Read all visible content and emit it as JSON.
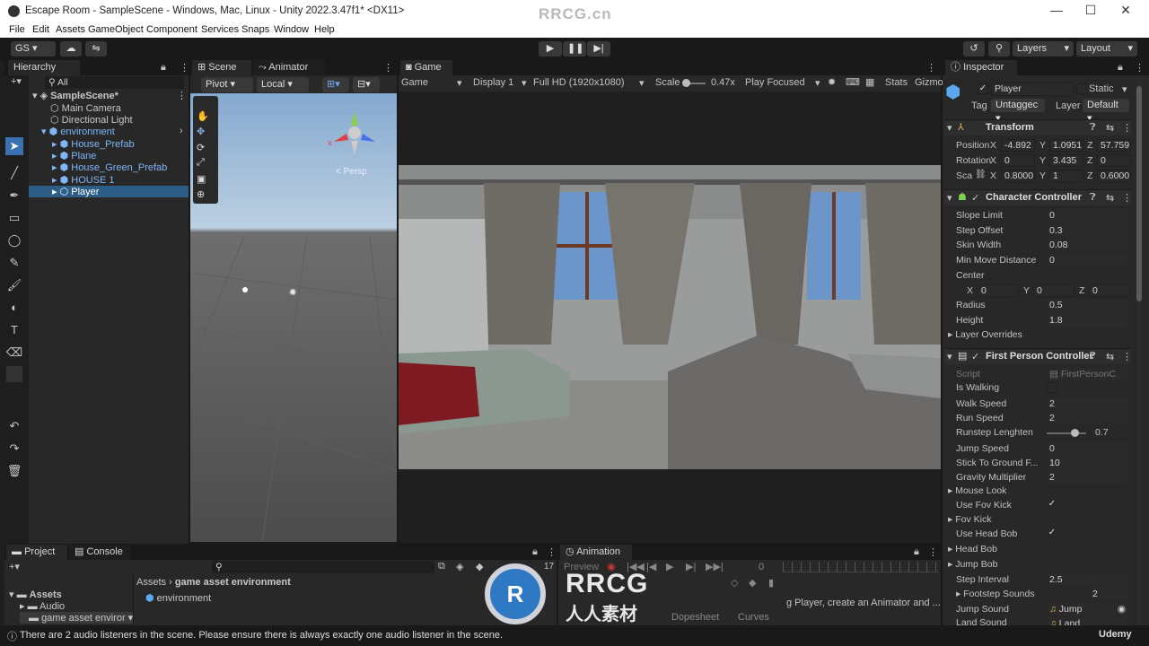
{
  "window": {
    "title": "Escape Room - SampleScene - Windows, Mac, Linux - Unity 2022.3.47f1* <DX11>",
    "watermark": "RRCG.cn",
    "minimize": "—",
    "maximize": "☐",
    "close": "✕"
  },
  "menu": [
    "File",
    "Edit",
    "Assets",
    "GameObject",
    "Component",
    "Services",
    "Snaps",
    "Window",
    "Help"
  ],
  "toolbar": {
    "account": "GS ▾",
    "layers": "Layers",
    "layout": "Layout"
  },
  "hierarchy": {
    "tab": "Hierarchy",
    "search_placeholder": "All",
    "scene": "SampleScene*",
    "items": [
      "Main Camera",
      "Directional Light",
      "environment",
      "House_Prefab",
      "Plane",
      "House_Green_Prefab",
      "HOUSE 1",
      "Player"
    ]
  },
  "scene": {
    "tab": "Scene",
    "tab2": "Animator",
    "pivot": "Pivot",
    "local": "Local",
    "persp": "< Persp",
    "axis_x": "x",
    "axis_z": "z",
    "axis_y": "y"
  },
  "game": {
    "tab": "Game",
    "mode": "Game",
    "display": "Display 1",
    "resolution": "Full HD (1920x1080)",
    "scale_label": "Scale",
    "scale_value": "0.47x",
    "play_mode": "Play Focused",
    "stats": "Stats",
    "gizmos": "Gizmo"
  },
  "inspector": {
    "tab": "Inspector",
    "object_name": "Player",
    "static_label": "Static",
    "tag_label": "Tag",
    "tag_value": "Untaggec",
    "layer_label": "Layer",
    "layer_value": "Default",
    "transform": {
      "title": "Transform",
      "position_label": "Position",
      "px": "-4.892",
      "py": "1.0951",
      "pz": "57.759",
      "rotation_label": "Rotation",
      "rx": "0",
      "ry": "3.435",
      "rz": "0",
      "scale_label": "Sca",
      "sx": "0.8000",
      "sy": "1",
      "sz": "0.6000",
      "x": "X",
      "y": "Y",
      "z": "Z"
    },
    "character_controller": {
      "title": "Character Controller",
      "slope_limit_label": "Slope Limit",
      "slope_limit": "0",
      "step_offset_label": "Step Offset",
      "step_offset": "0.3",
      "skin_width_label": "Skin Width",
      "skin_width": "0.08",
      "min_move_label": "Min Move Distance",
      "min_move": "0",
      "center_label": "Center",
      "cx": "0",
      "cy": "0",
      "cz": "0",
      "radius_label": "Radius",
      "radius": "0.5",
      "height_label": "Height",
      "height": "1.8",
      "layer_overrides": "Layer Overrides"
    },
    "fps_controller": {
      "title": "First Person Controller",
      "script_label": "Script",
      "script_value": "FirstPersonC",
      "is_walking": "Is Walking",
      "walk_speed_label": "Walk Speed",
      "walk_speed": "2",
      "run_speed_label": "Run Speed",
      "run_speed": "2",
      "runstep_label": "Runstep Lenghten",
      "runstep": "0.7",
      "runstep_fraction": 0.7,
      "jump_speed_label": "Jump Speed",
      "jump_speed": "0",
      "stick_label": "Stick To Ground F...",
      "stick": "10",
      "gravity_label": "Gravity Multiplier",
      "gravity": "2",
      "mouse_look": "Mouse Look",
      "use_fov_kick": "Use Fov Kick",
      "fov_kick": "Fov Kick",
      "use_head_bob": "Use Head Bob",
      "head_bob": "Head Bob",
      "jump_bob": "Jump Bob",
      "step_interval_label": "Step Interval",
      "step_interval": "2.5",
      "footstep_label": "Footstep Sounds",
      "footstep": "2",
      "jump_sound_label": "Jump Sound",
      "jump_sound": "Jump",
      "land_sound_label": "Land Sound",
      "land_sound": "Land"
    }
  },
  "project": {
    "tab": "Project",
    "tab2": "Console",
    "assets": "Assets",
    "audio": "Audio",
    "folder": "game asset enviror",
    "breadcrumb_root": "Assets",
    "breadcrumb_leaf": "game asset environment",
    "item": "environment",
    "count": "17"
  },
  "animation": {
    "tab": "Animation",
    "preview": "Preview",
    "frame": "0",
    "message": "g Player, create an Animator and ...",
    "dopesheet": "Dopesheet",
    "curves": "Curves"
  },
  "status": {
    "message": "There are 2 audio listeners in the scene. Please ensure there is always exactly one audio listener in the scene.",
    "brand": "Udemy"
  },
  "logo": {
    "main": "RRCG",
    "sub": "人人素材"
  }
}
